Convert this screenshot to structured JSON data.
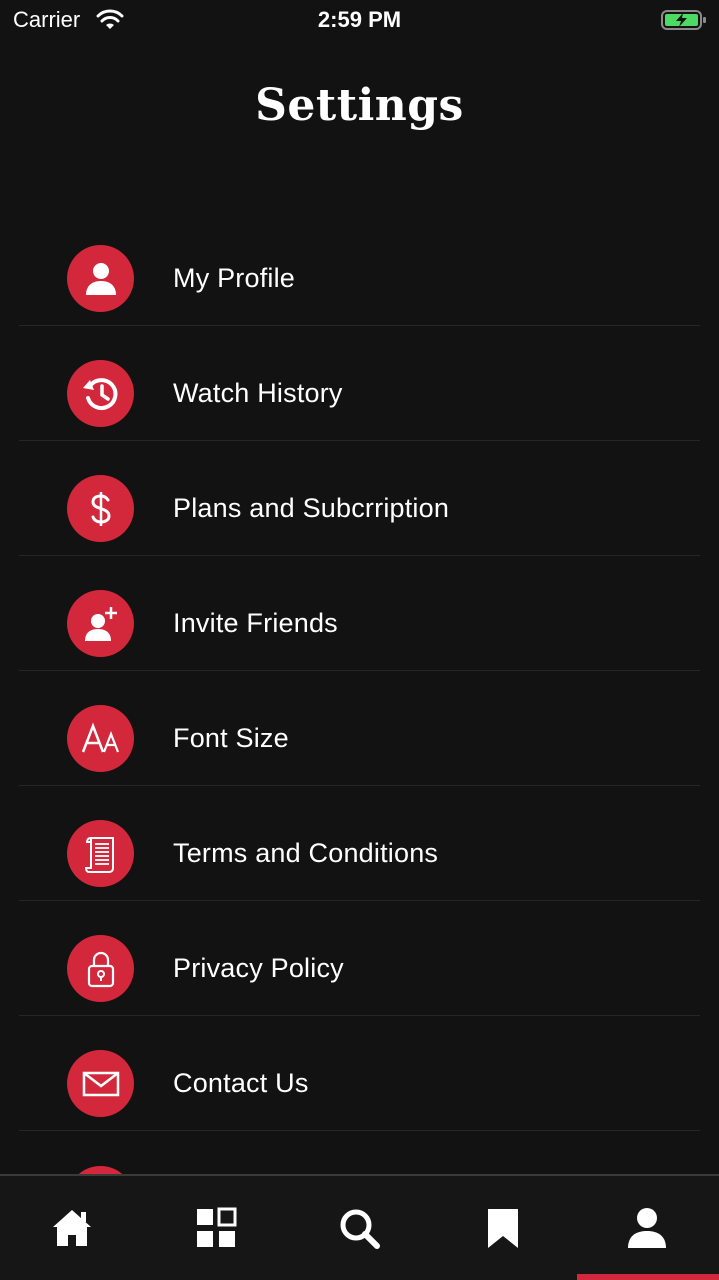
{
  "status_bar": {
    "carrier": "Carrier",
    "time": "2:59 PM"
  },
  "header": {
    "title": "Settings"
  },
  "settings": {
    "items": [
      {
        "label": "My Profile",
        "icon": "user-icon"
      },
      {
        "label": "Watch History",
        "icon": "history-icon"
      },
      {
        "label": "Plans and Subcrription",
        "icon": "dollar-icon"
      },
      {
        "label": "Invite Friends",
        "icon": "user-plus-icon"
      },
      {
        "label": "Font Size",
        "icon": "font-size-icon"
      },
      {
        "label": "Terms and Conditions",
        "icon": "scroll-icon"
      },
      {
        "label": "Privacy Policy",
        "icon": "lock-icon"
      },
      {
        "label": "Contact Us",
        "icon": "envelope-icon"
      }
    ]
  },
  "tab_bar": {
    "tabs": [
      {
        "icon": "home-icon"
      },
      {
        "icon": "grid-icon"
      },
      {
        "icon": "search-icon"
      },
      {
        "icon": "bookmark-icon"
      },
      {
        "icon": "profile-icon",
        "active": true
      }
    ]
  },
  "colors": {
    "background": "#121212",
    "accent": "#d3283b",
    "text": "#ffffff",
    "battery": "#4cd964"
  }
}
